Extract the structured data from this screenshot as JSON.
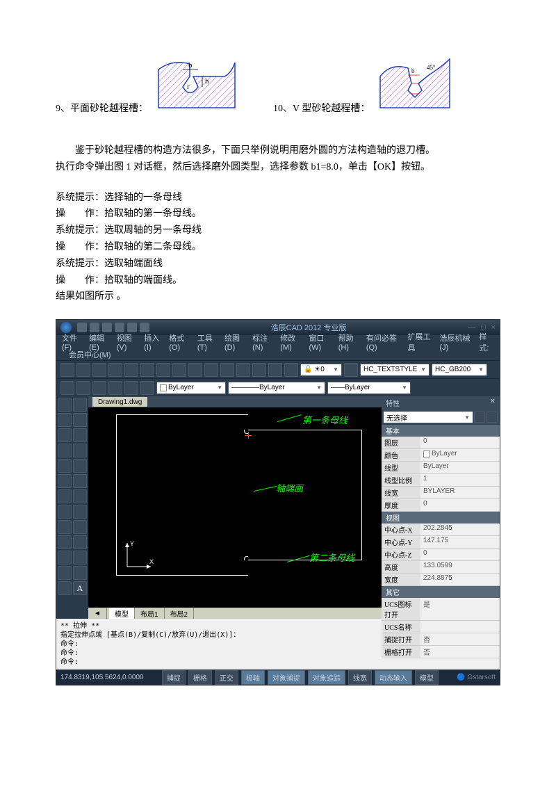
{
  "diagrams": {
    "item9_label": "9、平面砂轮越程槽：",
    "item10_label": "10、V 型砂轮越程槽：",
    "diag9_dims": {
      "b": "b",
      "r": "r",
      "h": "h"
    },
    "diag10_dims": {
      "b": "b",
      "angle": "45°"
    }
  },
  "paragraph": {
    "line1": "鉴于砂轮越程槽的构造方法很多，下面只举例说明用磨外圆的方法构造轴的退刀槽。",
    "line2": "执行命令弹出图 1 对话框，然后选择磨外圆类型，选择参数 b1=8.0，单击【OK】按钮。"
  },
  "steps": {
    "s1": "系统提示：选择轴的一条母线",
    "s2": "操　　作：拾取轴的第一条母线。",
    "s3": "系统提示：选取周轴的另一条母线",
    "s4": "操　　作：拾取轴的第二条母线。",
    "s5": "系统提示：选取轴端面线",
    "s6": "操　　作：拾取轴的端面线。",
    "s7": "结果如图所示 。"
  },
  "cad": {
    "title": "浩辰CAD 2012 专业版",
    "menu": [
      "文件(F)",
      "编辑(E)",
      "视图(V)",
      "插入(I)",
      "格式(O)",
      "工具(T)",
      "绘图(D)",
      "标注(N)",
      "修改(M)",
      "窗口(W)",
      "帮助(H)",
      "有问必答(Q)",
      "扩展工具",
      "浩辰机械(J)"
    ],
    "right_label": "样式:",
    "toolbar2": {
      "layer": "0",
      "textstyle": "HC_TEXTSTYLE",
      "dimstyle": "HC_GB200"
    },
    "toolbar3": {
      "bylayer1": "ByLayer",
      "bylayer2": "ByLayer",
      "bylayer3": "ByLayer"
    },
    "tab": "Drawing1.dwg",
    "annotations": {
      "top": "第一条母线",
      "mid": "轴端面",
      "bot": "第二条母线"
    },
    "bottom_tabs": [
      "模型",
      "布局1",
      "布局2"
    ],
    "props": {
      "title": "特性",
      "selection": "无选择",
      "groups": {
        "basic": {
          "header": "基本",
          "rows": [
            {
              "k": "图层",
              "v": "0"
            },
            {
              "k": "颜色",
              "v": "ByLayer"
            },
            {
              "k": "线型",
              "v": "ByLayer"
            },
            {
              "k": "线型比例",
              "v": "1"
            },
            {
              "k": "线宽",
              "v": "BYLAYER"
            },
            {
              "k": "厚度",
              "v": "0"
            }
          ]
        },
        "view": {
          "header": "视图",
          "rows": [
            {
              "k": "中心点-X",
              "v": "202.2845"
            },
            {
              "k": "中心点-Y",
              "v": "147.175"
            },
            {
              "k": "中心点-Z",
              "v": "0"
            },
            {
              "k": "高度",
              "v": "133.0599"
            },
            {
              "k": "宽度",
              "v": "224.8875"
            }
          ]
        },
        "misc": {
          "header": "其它",
          "rows": [
            {
              "k": "UCS图标打开",
              "v": "是"
            },
            {
              "k": "UCS名称",
              "v": ""
            },
            {
              "k": "捕捉打开",
              "v": "否"
            },
            {
              "k": "栅格打开",
              "v": "否"
            }
          ]
        }
      }
    },
    "cmdline": {
      "l1": "** 拉伸 **",
      "l2": "指定拉伸点或 [基点(B)/复制(C)/放弃(U)/退出(X)]：",
      "l3": "命令:",
      "l4": "命令:",
      "l5": "命令:"
    },
    "status": {
      "coords": "174.8319,105.5624,0.0000",
      "buttons": [
        "捕捉",
        "栅格",
        "正交",
        "极轴",
        "对象捕捉",
        "对象追踪",
        "线宽",
        "动态输入",
        "模型"
      ],
      "active_indices": [
        3,
        4,
        5,
        7
      ],
      "brand": "Gstarsoft"
    }
  }
}
